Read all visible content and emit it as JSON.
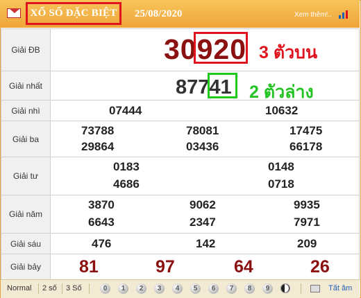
{
  "header": {
    "title": "XỔ SỐ ĐẶC BIỆT",
    "date": "25/08/2020",
    "more_link": "Xem thêm!.."
  },
  "prizes": {
    "db": {
      "label": "Giải ĐB",
      "prefix": "30",
      "highlight": "920",
      "note": "3 ตัวบน"
    },
    "g1": {
      "label": "Giải nhất",
      "prefix": "877",
      "highlight": "41",
      "note": "2 ตัวล่าง"
    },
    "g2": {
      "label": "Giải nhì",
      "values": [
        "07444",
        "10632"
      ]
    },
    "g3": {
      "label": "Giải ba",
      "values": [
        "73788",
        "78081",
        "17475",
        "29864",
        "03436",
        "66178"
      ]
    },
    "g4": {
      "label": "Giải tư",
      "values": [
        "0183",
        "0148",
        "4686",
        "0718"
      ]
    },
    "g5": {
      "label": "Giải năm",
      "values": [
        "3870",
        "9062",
        "9935",
        "6643",
        "2347",
        "7971"
      ]
    },
    "g6": {
      "label": "Giải sáu",
      "values": [
        "476",
        "142",
        "209"
      ]
    },
    "g7": {
      "label": "Giải bảy",
      "values": [
        "81",
        "97",
        "64",
        "26"
      ]
    }
  },
  "footer": {
    "tabs": [
      "Normal",
      "2 số",
      "3 Số"
    ],
    "digits": [
      "0",
      "1",
      "2",
      "3",
      "4",
      "5",
      "6",
      "7",
      "8",
      "9"
    ],
    "all_label": "Tất âm"
  },
  "colors": {
    "header_bg": "#f0a53a",
    "highlight_red": "#e0141e",
    "highlight_green": "#1ec81e",
    "prize_dark_red": "#8b1010"
  }
}
